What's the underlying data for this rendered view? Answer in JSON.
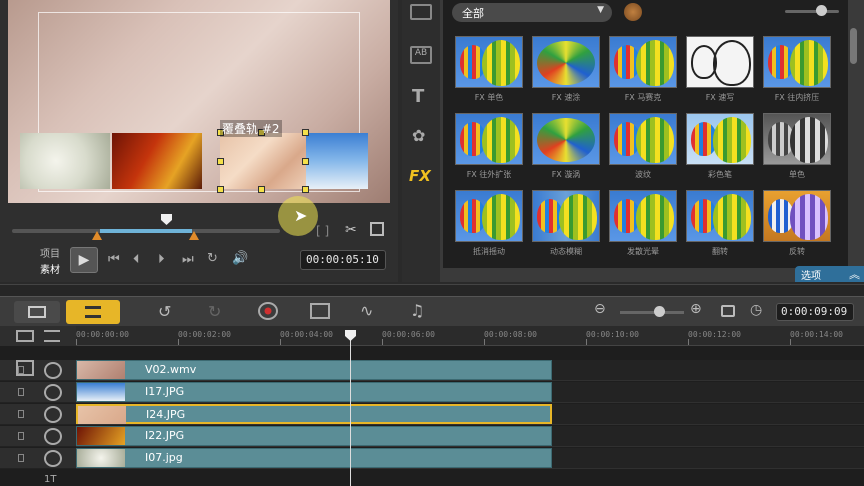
{
  "preview": {
    "track_label": "覆叠轨 #2",
    "mode_project": "项目",
    "mode_clip": "素材",
    "timecode": "00:00:05",
    "timecode_frames": "10"
  },
  "library": {
    "category_dropdown": "全部",
    "sidebar_fx_label": "FX",
    "filters": [
      {
        "label": "FX 单色"
      },
      {
        "label": "FX 速涂"
      },
      {
        "label": "FX 马赛克"
      },
      {
        "label": "FX 速写"
      },
      {
        "label": "FX 往内挤压"
      },
      {
        "label": "FX 往外扩张"
      },
      {
        "label": "FX 漩涡"
      },
      {
        "label": "波纹"
      },
      {
        "label": "彩色笔"
      },
      {
        "label": "单色"
      },
      {
        "label": "抵消摇动"
      },
      {
        "label": "动态模糊"
      },
      {
        "label": "发散光晕"
      },
      {
        "label": "翻转"
      },
      {
        "label": "反转"
      }
    ],
    "options_label": "选项"
  },
  "timeline": {
    "timecode": "0:00:09",
    "timecode_frames": "09",
    "ruler_labels": [
      "00:00:00:00",
      "00:00:02:00",
      "00:00:04:00",
      "00:00:06:00",
      "00:00:08:00",
      "00:00:10:00",
      "00:00:12:00",
      "00:00:14:00"
    ],
    "clips": [
      {
        "name": "V02.wmv"
      },
      {
        "name": "I17.JPG"
      },
      {
        "name": "I24.JPG"
      },
      {
        "name": "I22.JPG"
      },
      {
        "name": "I07.jpg"
      }
    ],
    "track_label_bottom": "1T",
    "add_track_label": "+/−"
  },
  "colors": {
    "accent_yellow": "#f4e04a",
    "clip_teal": "#5b8d96",
    "options_blue": "#2f6f9a"
  }
}
